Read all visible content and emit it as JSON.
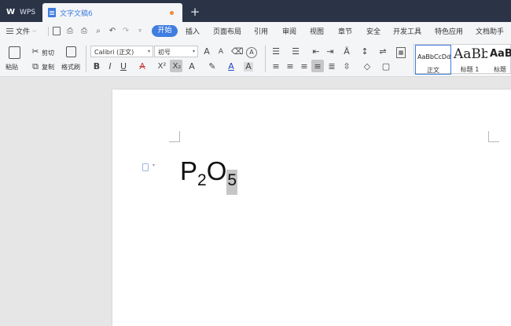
{
  "titlebar": {
    "app_tab": "WPS",
    "document_tab": "文字文稿6",
    "add_tab_label": "+"
  },
  "menubar": {
    "file_label": "文件",
    "active_tab": "开始",
    "tabs": [
      "插入",
      "页面布局",
      "引用",
      "审阅",
      "视图",
      "章节",
      "安全",
      "开发工具",
      "特色应用",
      "文档助手"
    ]
  },
  "ribbon": {
    "paste_label": "粘贴",
    "cut_label": "剪切",
    "copy_label": "复制",
    "format_painter_label": "格式刷",
    "font_name": "Calibri (正文)",
    "font_size": "初号",
    "styles": [
      {
        "preview": "AaBbCcDd",
        "label": "正文"
      },
      {
        "preview": "AaBb",
        "label": "标题 1"
      },
      {
        "preview": "AaBb",
        "label": "标题"
      }
    ]
  },
  "document": {
    "formula": {
      "p": "P",
      "sub1": "2",
      "o": "O",
      "sub2": "5"
    }
  },
  "colors": {
    "accent": "#3f7de0",
    "titlebar": "#2b3447",
    "toolbar_bg": "#f4f5f7",
    "selection": "#c6c6c6"
  },
  "icons": [
    "wps-logo-icon",
    "document-icon",
    "hamburger-menu-icon",
    "save-icon",
    "print-icon",
    "undo-icon",
    "redo-icon",
    "paste-icon",
    "cut-icon",
    "copy-icon",
    "format-painter-icon",
    "bold-icon",
    "italic-icon",
    "underline-icon",
    "subscript-icon",
    "superscript-icon",
    "clear-format-icon",
    "font-color-icon",
    "highlight-icon",
    "bullet-list-icon",
    "numbered-list-icon",
    "align-left-icon",
    "align-center-icon",
    "align-right-icon",
    "justify-icon",
    "paragraph-handle-icon"
  ]
}
